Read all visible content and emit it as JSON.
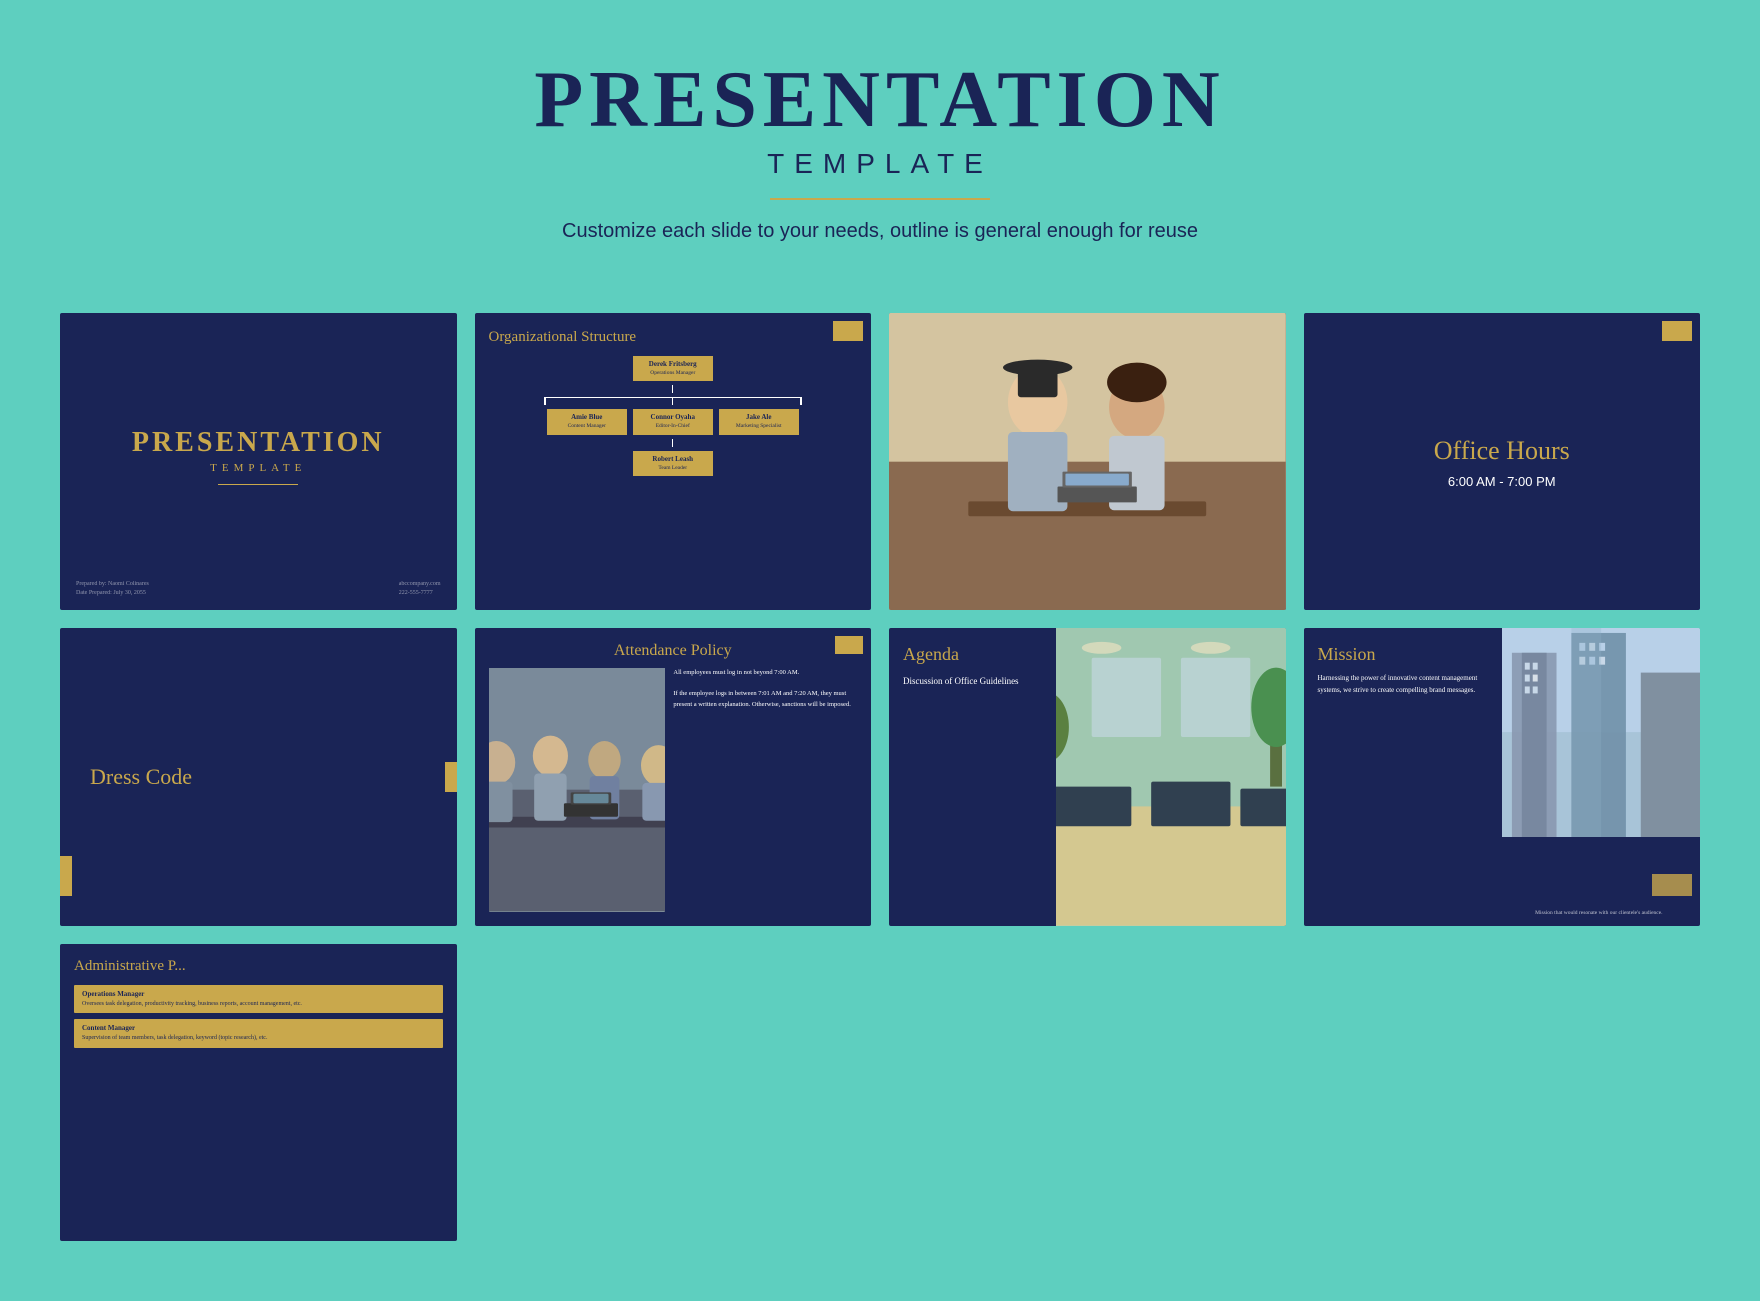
{
  "header": {
    "main_title": "PRESENTATION",
    "sub_title": "TEMPLATE",
    "divider": true,
    "description": "Customize each slide to your needs, outline is general enough for reuse"
  },
  "slides": {
    "slide1": {
      "title": "PRESENTATION",
      "subtitle": "TEMPLATE",
      "prepared_by": "Prepared by: Naomi Colinares",
      "date_prepared": "Date Prepared: July 30, 2055",
      "website": "abccompany.com",
      "phone": "222-555-7777"
    },
    "slide2": {
      "title": "Organizational Structure",
      "ceo": "Derek Fritsberg",
      "ceo_role": "Operations Manager",
      "left": "Amie Blue",
      "left_role": "Content Manager",
      "center": "Connor Oyaha",
      "center_role": "Editor-In-Chief",
      "right": "Jake Ale",
      "right_role": "Marketing Specialist",
      "bottom": "Robert Leash",
      "bottom_role": "Team Leader"
    },
    "slide3": {
      "alt_text": "Two women working on laptop"
    },
    "slide4": {
      "title": "Office Hours",
      "hours": "6:00 AM - 7:00 PM"
    },
    "slide5": {
      "title": "Dress Code"
    },
    "slide6": {
      "title": "Attendance Policy",
      "text1": "All employees must log in not beyond 7:00 AM.",
      "text2": "If the employee logs in between 7:01 AM and 7:20 AM, they must present a written explanation. Otherwise, sanctions will be imposed."
    },
    "slide7": {
      "title": "Agenda",
      "body": "Discussion of Office Guidelines"
    },
    "slide8": {
      "title": "Mission",
      "body": "Harnessing the power of innovative content management systems, we strive to create compelling brand messages.",
      "footer": "Mission that would resonate with our clientele's audience."
    },
    "slide9": {
      "title": "Administrative P...",
      "role1_title": "Operations Manager",
      "role1_desc": "Oversees task delegation, productivity tracking, business reports, account management, etc.",
      "role2_title": "Content Manager",
      "role2_desc": "Supervision of team members, task delegation, keyword (topic research), etc."
    }
  }
}
